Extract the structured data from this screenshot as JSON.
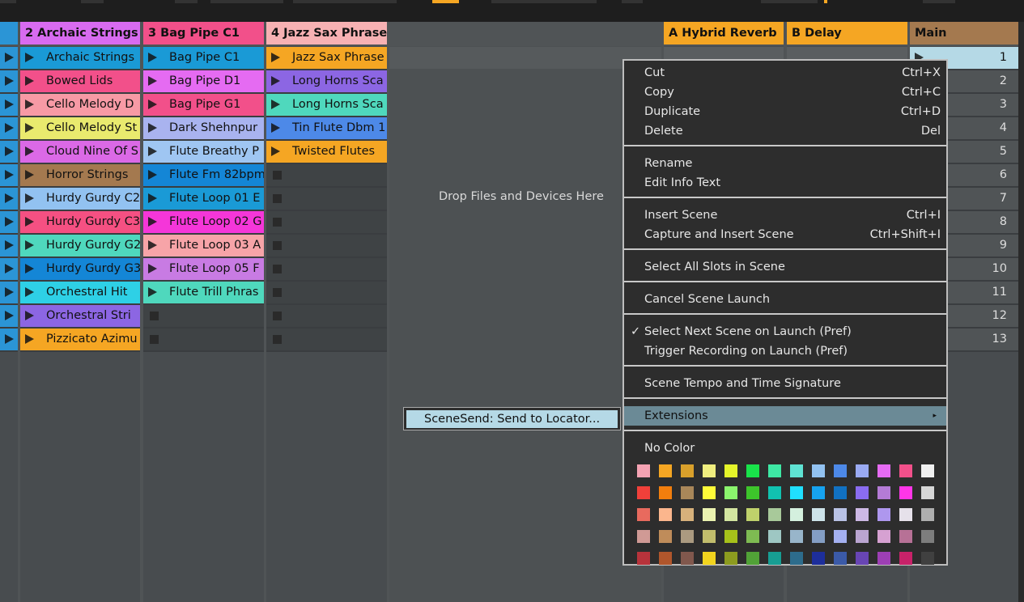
{
  "tracks": [
    {
      "id": "t1",
      "header": "",
      "header_color": "#2b95d6",
      "clip_count": 13
    },
    {
      "id": "t2",
      "header": "2 Archaic Strings",
      "header_color": "#d86bf0",
      "clips": [
        {
          "name": "Archaic Strings",
          "color": "#1a9ad6"
        },
        {
          "name": "Bowed Lids",
          "color": "#f2508a"
        },
        {
          "name": "Cello Melody D",
          "color": "#f79aa5"
        },
        {
          "name": "Cello Melody St",
          "color": "#e9ea6e"
        },
        {
          "name": "Cloud Nine Of S",
          "color": "#db69e6"
        },
        {
          "name": "Horror Strings",
          "color": "#a4794f"
        },
        {
          "name": "Hurdy Gurdy C2",
          "color": "#92c2f1"
        },
        {
          "name": "Hurdy Gurdy C3",
          "color": "#f55082"
        },
        {
          "name": "Hurdy Gurdy G2",
          "color": "#4fd8bd"
        },
        {
          "name": "Hurdy Gurdy G3",
          "color": "#1486d6"
        },
        {
          "name": "Orchestral Hit",
          "color": "#2ed0e6"
        },
        {
          "name": "Orchestral Stri",
          "color": "#8c66e3"
        },
        {
          "name": "Pizzicato Azimu",
          "color": "#f5a623"
        }
      ]
    },
    {
      "id": "t3",
      "header": "3 Bag Pipe C1",
      "header_color": "#f2508a",
      "clips": [
        {
          "name": "Bag Pipe C1",
          "color": "#1a9ad6"
        },
        {
          "name": "Bag Pipe D1",
          "color": "#e56bf2"
        },
        {
          "name": "Bag Pipe G1",
          "color": "#f2508a"
        },
        {
          "name": "Dark Shehnpur",
          "color": "#a9b3ef"
        },
        {
          "name": "Flute Breathy P",
          "color": "#9fc6f2"
        },
        {
          "name": "Flute Fm 82bpm",
          "color": "#1486d6"
        },
        {
          "name": "Flute Loop 01 E",
          "color": "#1a9ad6"
        },
        {
          "name": "Flute Loop 02 G",
          "color": "#f536d9"
        },
        {
          "name": "Flute Loop 03 A",
          "color": "#f7a4a8"
        },
        {
          "name": "Flute Loop 05 F",
          "color": "#c87be3"
        },
        {
          "name": "Flute Trill Phras",
          "color": "#4fd8bd"
        }
      ]
    },
    {
      "id": "t4",
      "header": "4 Jazz Sax Phrase",
      "header_color": "#f7b1b3",
      "clips": [
        {
          "name": "Jazz Sax Phrase",
          "color": "#f5a623"
        },
        {
          "name": "Long Horns Sca",
          "color": "#8c66e3"
        },
        {
          "name": "Long Horns Sca",
          "color": "#4fd8bd"
        },
        {
          "name": "Tin Flute Dbm 1",
          "color": "#4d89e8"
        },
        {
          "name": "Twisted Flutes",
          "color": "#f5a623"
        }
      ]
    }
  ],
  "returns": [
    {
      "header": "A Hybrid Reverb",
      "header_color": "#f5a623"
    },
    {
      "header": "B Delay",
      "header_color": "#f5a623"
    }
  ],
  "main": {
    "header": "Main",
    "header_color": "#a4794f",
    "scenes": [
      "1",
      "2",
      "3",
      "4",
      "5",
      "6",
      "7",
      "8",
      "9",
      "10",
      "11",
      "12",
      "13"
    ]
  },
  "drop_zone_text": "Drop Files and Devices Here",
  "context_menu": {
    "groups": [
      [
        {
          "label": "Cut",
          "shortcut": "Ctrl+X"
        },
        {
          "label": "Copy",
          "shortcut": "Ctrl+C"
        },
        {
          "label": "Duplicate",
          "shortcut": "Ctrl+D"
        },
        {
          "label": "Delete",
          "shortcut": "Del"
        }
      ],
      [
        {
          "label": "Rename",
          "shortcut": ""
        },
        {
          "label": "Edit Info Text",
          "shortcut": ""
        }
      ],
      [
        {
          "label": "Insert Scene",
          "shortcut": "Ctrl+I"
        },
        {
          "label": "Capture and Insert Scene",
          "shortcut": "Ctrl+Shift+I"
        }
      ],
      [
        {
          "label": "Select All Slots in Scene",
          "shortcut": ""
        }
      ],
      [
        {
          "label": "Cancel Scene Launch",
          "shortcut": ""
        }
      ],
      [
        {
          "label": "Select Next Scene on Launch (Pref)",
          "shortcut": "",
          "checked": true
        },
        {
          "label": "Trigger Recording on Launch (Pref)",
          "shortcut": ""
        }
      ],
      [
        {
          "label": "Scene Tempo and Time Signature",
          "shortcut": ""
        }
      ],
      [
        {
          "label": "Extensions",
          "shortcut": "",
          "highlighted": true,
          "submenu": true
        }
      ]
    ],
    "no_color_label": "No Color",
    "check_glyph": "✓",
    "swatches": [
      [
        "#f4a3b3",
        "#f5a623",
        "#d9a02b",
        "#f0ee7f",
        "#e5f52a",
        "#19e34a",
        "#3ee8a4",
        "#5fe3d3",
        "#92c2f1",
        "#4d89e8",
        "#9aaaf2",
        "#e56bf2",
        "#f2508a",
        "#f0f0f0"
      ],
      [
        "#f1403a",
        "#f27e0d",
        "#a98759",
        "#fffb39",
        "#8bf56d",
        "#3dc52b",
        "#11c2b0",
        "#20e0ff",
        "#16a3f0",
        "#1171c2",
        "#8a6cf0",
        "#b47bd6",
        "#ff36e8",
        "#d6d6d6"
      ],
      [
        "#e86a5e",
        "#fbb68d",
        "#d7b17b",
        "#eaf2b0",
        "#d3e5a0",
        "#bfd16b",
        "#a8c99a",
        "#d4f0de",
        "#cde3e9",
        "#b9c2e5",
        "#cdb9e5",
        "#ae97ee",
        "#e6e1ea",
        "#aeaeae"
      ],
      [
        "#d09a95",
        "#bf8c5a",
        "#ab9a80",
        "#c2bd6c",
        "#a6c11a",
        "#7ebb52",
        "#9ec7c3",
        "#98b5ca",
        "#849ec4",
        "#a4b0f0",
        "#baa5d1",
        "#d6a1d2",
        "#b77196",
        "#7d7d7d"
      ],
      [
        "#b8333b",
        "#b0562c",
        "#81584d",
        "#f2d41e",
        "#8c9b1f",
        "#51a237",
        "#179e93",
        "#2d6c8c",
        "#1d2e9b",
        "#3b5aa8",
        "#6845b4",
        "#9d3fb4",
        "#c82269",
        "#404040"
      ]
    ]
  },
  "submenu_item": "SceneSend: Send to Locator..."
}
